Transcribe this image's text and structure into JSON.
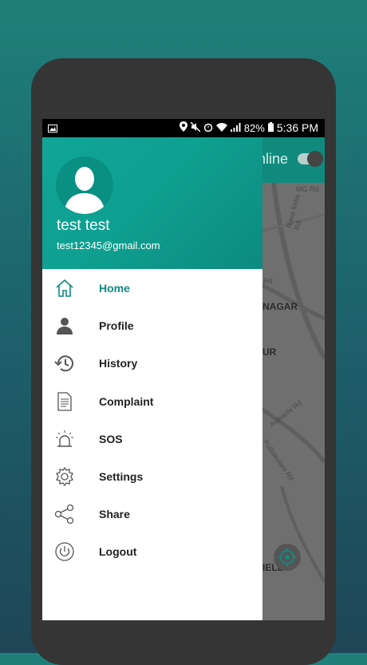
{
  "status_bar": {
    "battery": "82%",
    "time": "5:36 PM"
  },
  "app_bar": {
    "online_label": "nline"
  },
  "map": {
    "labels": [
      "NAGAR",
      "UR",
      "IELDS"
    ],
    "roads": [
      "MG Rd",
      "Nava India Rd",
      "Rd",
      "Avinashi Rd",
      "Pulliakulam Rd"
    ]
  },
  "user": {
    "name": "test test",
    "email": "test12345@gmail.com"
  },
  "menu": [
    {
      "label": "Home",
      "icon": "home-icon"
    },
    {
      "label": "Profile",
      "icon": "person-icon"
    },
    {
      "label": "History",
      "icon": "history-icon"
    },
    {
      "label": "Complaint",
      "icon": "document-icon"
    },
    {
      "label": "SOS",
      "icon": "alarm-icon"
    },
    {
      "label": "Settings",
      "icon": "gear-icon"
    },
    {
      "label": "Share",
      "icon": "share-icon"
    },
    {
      "label": "Logout",
      "icon": "power-icon"
    }
  ],
  "colors": {
    "accent": "#0f8a80",
    "header": "#11a597"
  }
}
